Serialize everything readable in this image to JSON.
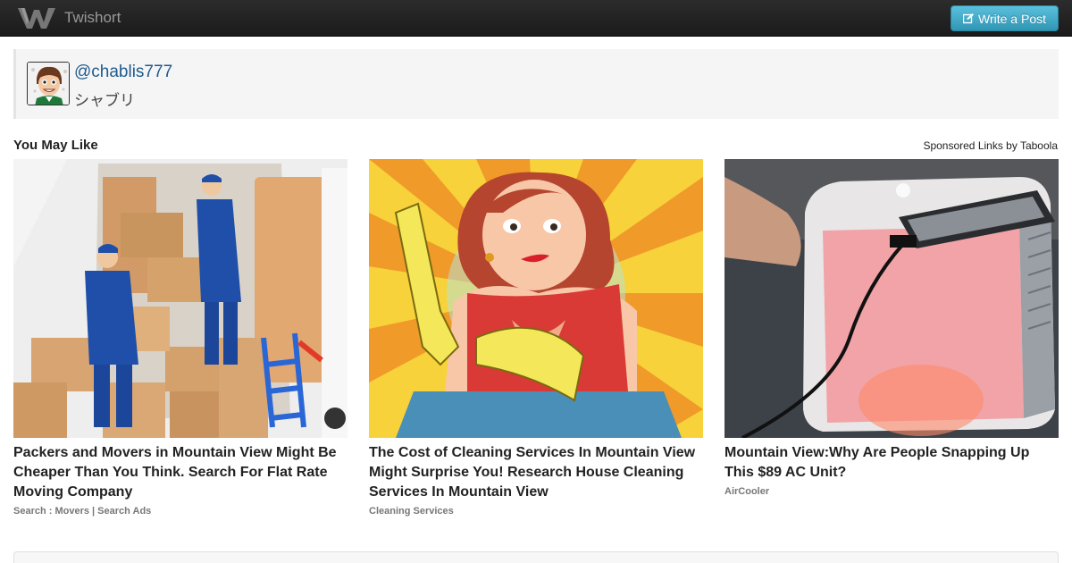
{
  "navbar": {
    "brand_name": "Twishort",
    "write_button_label": "Write a Post",
    "logo_icon": "twishort-logo-icon",
    "write_icon": "edit-icon"
  },
  "profile": {
    "handle": "@chablis777",
    "display_name": "シャブリ",
    "avatar_icon": "avatar"
  },
  "recommendations": {
    "title": "You May Like",
    "sponsored_text": "Sponsored Links by Taboola",
    "cards": [
      {
        "title": "Packers and Movers in Mountain View Might Be Cheaper Than You Think. Search For Flat Rate Moving Company",
        "source": "Search : Movers | Search Ads"
      },
      {
        "title": "The Cost of Cleaning Services In Mountain View Might Surprise You! Research House Cleaning Services In Mountain View",
        "source": "Cleaning Services"
      },
      {
        "title": "Mountain View:Why Are People Snapping Up This $89 AC Unit?",
        "source": "AirCooler"
      }
    ]
  },
  "colors": {
    "navbar": "#222222",
    "button": "#49afcd",
    "link": "#1e5b8e"
  }
}
